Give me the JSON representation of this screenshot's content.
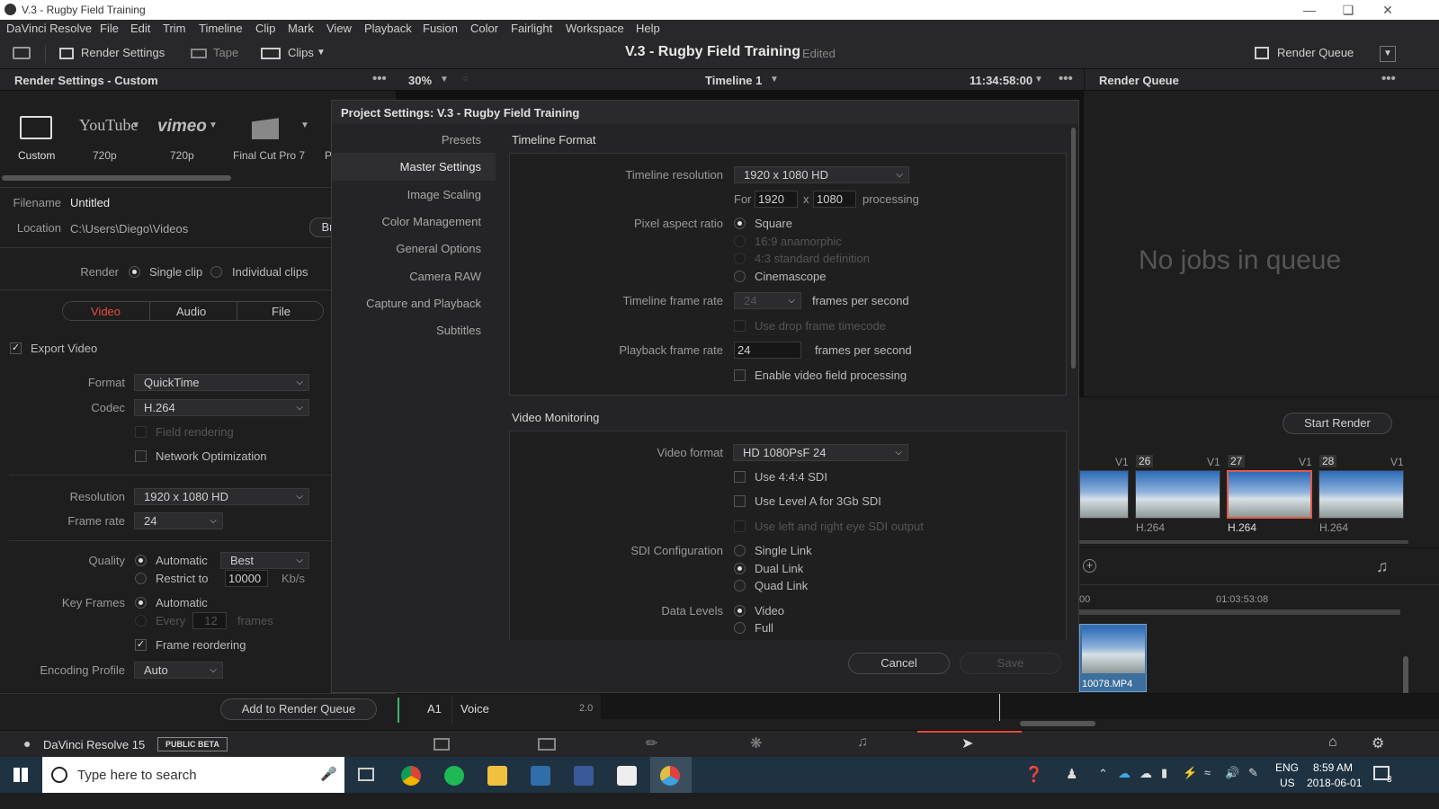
{
  "window": {
    "title": "V.3 - Rugby Field Training"
  },
  "menu": [
    "DaVinci Resolve",
    "File",
    "Edit",
    "Trim",
    "Timeline",
    "Clip",
    "Mark",
    "View",
    "Playback",
    "Fusion",
    "Color",
    "Fairlight",
    "Workspace",
    "Help"
  ],
  "toolbar": {
    "render_settings": "Render Settings",
    "tape": "Tape",
    "clips": "Clips",
    "project_title": "V.3 - Rugby Field Training",
    "edited": "Edited",
    "render_queue": "Render Queue"
  },
  "header": {
    "left_title": "Render Settings - Custom",
    "zoom": "30%",
    "timeline": "Timeline 1",
    "timecode": "11:34:58:00",
    "right_title": "Render Queue"
  },
  "presets": [
    {
      "name": "Custom",
      "sub": ""
    },
    {
      "name": "YouTube",
      "sub": "720p"
    },
    {
      "name": "vimeo",
      "sub": "720p"
    },
    {
      "name": "",
      "sub": "Final Cut Pro 7"
    },
    {
      "name": "",
      "sub": "P"
    }
  ],
  "render": {
    "filename_label": "Filename",
    "filename": "Untitled",
    "location_label": "Location",
    "location": "C:\\Users\\Diego\\Videos",
    "browse": "Br",
    "render_label": "Render",
    "single_clip": "Single clip",
    "individual_clips": "Individual clips",
    "tabs": [
      "Video",
      "Audio",
      "File"
    ],
    "export_video": "Export Video",
    "format_label": "Format",
    "format": "QuickTime",
    "codec_label": "Codec",
    "codec": "H.264",
    "field_rendering": "Field rendering",
    "network_opt": "Network Optimization",
    "resolution_label": "Resolution",
    "resolution": "1920 x 1080 HD",
    "framerate_label": "Frame rate",
    "framerate": "24",
    "quality_label": "Quality",
    "automatic": "Automatic",
    "best": "Best",
    "restrict_to": "Restrict to",
    "restrict_val": "10000",
    "kbs": "Kb/s",
    "keyframes_label": "Key Frames",
    "kf_auto": "Automatic",
    "kf_every": "Every",
    "kf_val": "12",
    "frames": "frames",
    "frame_reordering": "Frame reordering",
    "encoding_label": "Encoding Profile",
    "encoding": "Auto",
    "add_queue": "Add to Render Queue"
  },
  "dialog": {
    "title": "Project Settings:  V.3 - Rugby Field Training",
    "nav": [
      "Presets",
      "Master Settings",
      "Image Scaling",
      "Color Management",
      "General Options",
      "Camera RAW",
      "Capture and Playback",
      "Subtitles"
    ],
    "timeline_format": "Timeline Format",
    "tl_res_label": "Timeline resolution",
    "tl_res": "1920 x 1080 HD",
    "for": "For",
    "w": "1920",
    "x": "x",
    "h": "1080",
    "processing": "processing",
    "par_label": "Pixel aspect ratio",
    "par": [
      "Square",
      "16:9 anamorphic",
      "4:3 standard definition",
      "Cinemascope"
    ],
    "tl_fps_label": "Timeline frame rate",
    "tl_fps": "24",
    "fps_unit": "frames per second",
    "drop_frame": "Use drop frame timecode",
    "pb_fps_label": "Playback frame rate",
    "pb_fps": "24",
    "field_proc": "Enable video field processing",
    "video_monitoring": "Video Monitoring",
    "vf_label": "Video format",
    "vf": "HD 1080PsF 24",
    "sdi444": "Use 4:4:4 SDI",
    "levelA": "Use Level A for 3Gb SDI",
    "lr_eye": "Use left and right eye SDI output",
    "sdi_label": "SDI Configuration",
    "sdi": [
      "Single Link",
      "Dual Link",
      "Quad Link"
    ],
    "dl_label": "Data Levels",
    "dl": [
      "Video",
      "Full"
    ],
    "cancel": "Cancel",
    "save": "Save"
  },
  "queue": {
    "empty": "No jobs in queue",
    "start": "Start Render"
  },
  "clips": [
    {
      "num": "",
      "track": "V1",
      "codec": ""
    },
    {
      "num": "26",
      "track": "V1",
      "codec": "H.264"
    },
    {
      "num": "27",
      "track": "V1",
      "codec": "H.264"
    },
    {
      "num": "28",
      "track": "V1",
      "codec": "H.264"
    }
  ],
  "timeline": {
    "tc1": "00",
    "tc2": "01:03:53:08",
    "clip_name": "10078.MP4",
    "audio_track": "A1",
    "audio_name": "Voice",
    "audio_ch": "2.0"
  },
  "bottom": {
    "app": "DaVinci Resolve 15",
    "beta": "PUBLIC BETA"
  },
  "taskbar": {
    "search": "Type here to search",
    "lang1": "ENG",
    "lang2": "US",
    "time": "8:59 AM",
    "date": "2018-06-01",
    "notif": "3"
  }
}
